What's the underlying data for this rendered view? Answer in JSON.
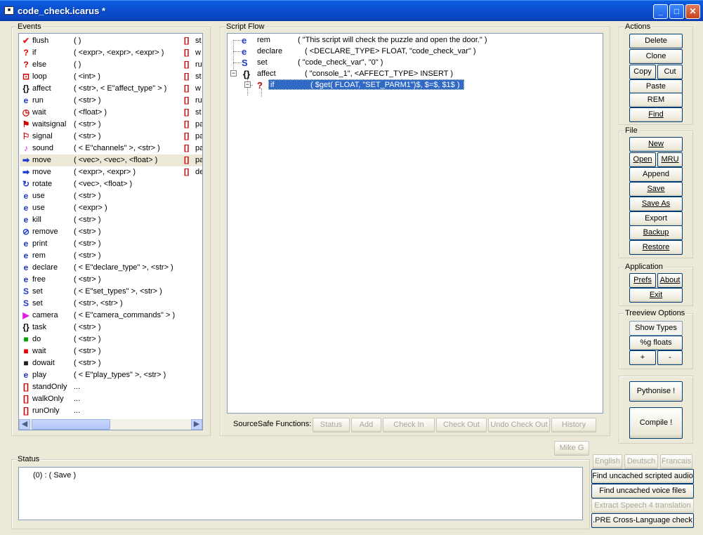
{
  "window": {
    "title": "code_check.icarus *",
    "app_icon": "icarus-app-icon"
  },
  "events_panel": {
    "label": "Events",
    "items": [
      {
        "icon": "flush-icon",
        "glyph": "✔",
        "color": "#e0201a",
        "name": "flush",
        "args": "(  )",
        "col2": "[]",
        "col2_text": "st"
      },
      {
        "icon": "if-icon",
        "glyph": "?",
        "color": "#d00000",
        "name": "if",
        "args": "( <expr>, <expr>, <expr> )",
        "col2": "[]",
        "col2_text": "w"
      },
      {
        "icon": "else-icon",
        "glyph": "?",
        "color": "#d00000",
        "name": "else",
        "args": "(  )",
        "col2": "[]",
        "col2_text": "ru"
      },
      {
        "icon": "loop-icon",
        "glyph": "⊡",
        "color": "#d00000",
        "name": "loop",
        "args": "( <int> )",
        "col2": "[]",
        "col2_text": "st"
      },
      {
        "icon": "affect-icon",
        "glyph": "{}",
        "color": "#000000",
        "name": "affect",
        "args": "( <str>, < E\"affect_type\" > )",
        "col2": "[]",
        "col2_text": "w"
      },
      {
        "icon": "run-icon",
        "glyph": "e",
        "color": "#1b38c8",
        "name": "run",
        "args": "( <str> )",
        "col2": "[]",
        "col2_text": "ru"
      },
      {
        "icon": "wait-icon",
        "glyph": "◷",
        "color": "#d00000",
        "name": "wait",
        "args": "( <float> )",
        "col2": "[]",
        "col2_text": "st"
      },
      {
        "icon": "waitsignal-icon",
        "glyph": "⚑",
        "color": "#d00000",
        "name": "waitsignal",
        "args": "( <str> )",
        "col2": "[]",
        "col2_text": "pa"
      },
      {
        "icon": "signal-icon",
        "glyph": "⚐",
        "color": "#d00000",
        "name": "signal",
        "args": "( <str> )",
        "col2": "[]",
        "col2_text": "pa"
      },
      {
        "icon": "sound-icon",
        "glyph": "♪",
        "color": "#e020e0",
        "name": "sound",
        "args": "( < E\"channels\" >, <str> )",
        "col2": "[]",
        "col2_text": "pa"
      },
      {
        "icon": "move-icon",
        "glyph": "➡",
        "color": "#1b38c8",
        "name": "move",
        "args": "( <vec>, <vec>, <float> )",
        "col2": "[]",
        "col2_text": "pa",
        "selected": true
      },
      {
        "icon": "move-icon",
        "glyph": "➡",
        "color": "#1b38c8",
        "name": "move",
        "args": "( <expr>, <expr> )",
        "col2": "[]",
        "col2_text": "de"
      },
      {
        "icon": "rotate-icon",
        "glyph": "↻",
        "color": "#1b38c8",
        "name": "rotate",
        "args": "( <vec>, <float> )",
        "col2": "",
        "col2_text": ""
      },
      {
        "icon": "use-icon",
        "glyph": "e",
        "color": "#1b38c8",
        "name": "use",
        "args": "( <str> )",
        "col2": "",
        "col2_text": ""
      },
      {
        "icon": "use-icon",
        "glyph": "e",
        "color": "#1b38c8",
        "name": "use",
        "args": "( <expr> )",
        "col2": "",
        "col2_text": ""
      },
      {
        "icon": "kill-icon",
        "glyph": "e",
        "color": "#1b38c8",
        "name": "kill",
        "args": "( <str> )",
        "col2": "",
        "col2_text": ""
      },
      {
        "icon": "remove-icon",
        "glyph": "⊘",
        "color": "#1b38c8",
        "name": "remove",
        "args": "( <str> )",
        "col2": "",
        "col2_text": ""
      },
      {
        "icon": "print-icon",
        "glyph": "e",
        "color": "#1b38c8",
        "name": "print",
        "args": "( <str> )",
        "col2": "",
        "col2_text": ""
      },
      {
        "icon": "rem-icon",
        "glyph": "e",
        "color": "#1b38c8",
        "name": "rem",
        "args": "( <str> )",
        "col2": "",
        "col2_text": ""
      },
      {
        "icon": "declare-icon",
        "glyph": "e",
        "color": "#1b38c8",
        "name": "declare",
        "args": "( < E\"declare_type\" >, <str> )",
        "col2": "",
        "col2_text": ""
      },
      {
        "icon": "free-icon",
        "glyph": "e",
        "color": "#1b38c8",
        "name": "free",
        "args": "( <str> )",
        "col2": "",
        "col2_text": ""
      },
      {
        "icon": "set-icon",
        "glyph": "S",
        "color": "#1b38c8",
        "name": "set",
        "args": "( < E\"set_types\" >, <str> )",
        "col2": "",
        "col2_text": ""
      },
      {
        "icon": "set-icon",
        "glyph": "S",
        "color": "#1b38c8",
        "name": "set",
        "args": "( <str>, <str> )",
        "col2": "",
        "col2_text": ""
      },
      {
        "icon": "camera-icon",
        "glyph": "▶",
        "color": "#e020e0",
        "name": "camera",
        "args": "( < E\"camera_commands\" > )",
        "col2": "",
        "col2_text": ""
      },
      {
        "icon": "task-icon",
        "glyph": "{}",
        "color": "#000000",
        "name": "task",
        "args": "( <str> )",
        "col2": "",
        "col2_text": ""
      },
      {
        "icon": "do-icon",
        "glyph": "■",
        "color": "#00a000",
        "name": "do",
        "args": "( <str> )",
        "col2": "",
        "col2_text": ""
      },
      {
        "icon": "wait-task-icon",
        "glyph": "■",
        "color": "#e00000",
        "name": "wait",
        "args": "( <str> )",
        "col2": "",
        "col2_text": ""
      },
      {
        "icon": "dowait-icon",
        "glyph": "■",
        "color": "#202020",
        "name": "dowait",
        "args": "( <str> )",
        "col2": "",
        "col2_text": ""
      },
      {
        "icon": "play-icon",
        "glyph": "e",
        "color": "#1b38c8",
        "name": "play",
        "args": "( < E\"play_types\" >, <str> )",
        "col2": "",
        "col2_text": ""
      },
      {
        "icon": "standonly-icon",
        "glyph": "[]",
        "color": "#d00000",
        "name": "standOnly",
        "args": "...",
        "col2": "",
        "col2_text": ""
      },
      {
        "icon": "walkonly-icon",
        "glyph": "[]",
        "color": "#d00000",
        "name": "walkOnly",
        "args": "...",
        "col2": "",
        "col2_text": ""
      },
      {
        "icon": "runonly-icon",
        "glyph": "[]",
        "color": "#d00000",
        "name": "runOnly",
        "args": "...",
        "col2": "",
        "col2_text": ""
      }
    ]
  },
  "script_flow": {
    "label": "Script Flow",
    "rows": [
      {
        "glyph": "e",
        "name": "rem",
        "args": "( \"This script will check the puzzle and open the door.\" )"
      },
      {
        "glyph": "e",
        "name": "declare",
        "args": "( <DECLARE_TYPE> FLOAT, \"code_check_var\" )"
      },
      {
        "glyph": "S",
        "name": "set",
        "args": "( \"code_check_var\", \"0\" )"
      },
      {
        "glyph": "{}",
        "name": "affect",
        "args": "( \"console_1\", <AFFECT_TYPE> INSERT )"
      },
      {
        "glyph": "?",
        "name": "if",
        "args": "( $get( FLOAT, \"SET_PARM1\")$, $=$, $1$ )"
      }
    ],
    "expander_minus": "−",
    "sourcesafe": {
      "label": "SourceSafe Functions:",
      "buttons": [
        "Status",
        "Add",
        "Check In",
        "Check Out",
        "Undo Check Out",
        "History"
      ]
    }
  },
  "actions": {
    "label": "Actions",
    "delete": "Delete",
    "clone": "Clone",
    "copy": "Copy",
    "cut": "Cut",
    "paste": "Paste",
    "rem": "REM",
    "find": "Find"
  },
  "file": {
    "label": "File",
    "new": "New",
    "open": "Open",
    "mru": "MRU",
    "append": "Append",
    "save": "Save",
    "save_as": "Save As",
    "export": "Export",
    "backup": "Backup",
    "restore": "Restore"
  },
  "application": {
    "label": "Application",
    "prefs": "Prefs",
    "about": "About",
    "exit": "Exit"
  },
  "treeview_options": {
    "label": "Treeview Options",
    "show_types": "Show Types",
    "g_floats": "%g floats",
    "plus": "+",
    "minus": "-"
  },
  "compile_box": {
    "pythonise": "Pythonise !",
    "compile": "Compile !"
  },
  "user_button": "Mike G",
  "status": {
    "label": "Status",
    "text": "(0) : ( Save )"
  },
  "languages": [
    "English",
    "Deutsch",
    "Francais"
  ],
  "tools": {
    "find_audio": "Find uncached scripted audio",
    "find_voice": "Find uncached voice files",
    "extract_speech": "Extract Speech 4 translation",
    "pre_check": ".PRE Cross-Language check"
  }
}
